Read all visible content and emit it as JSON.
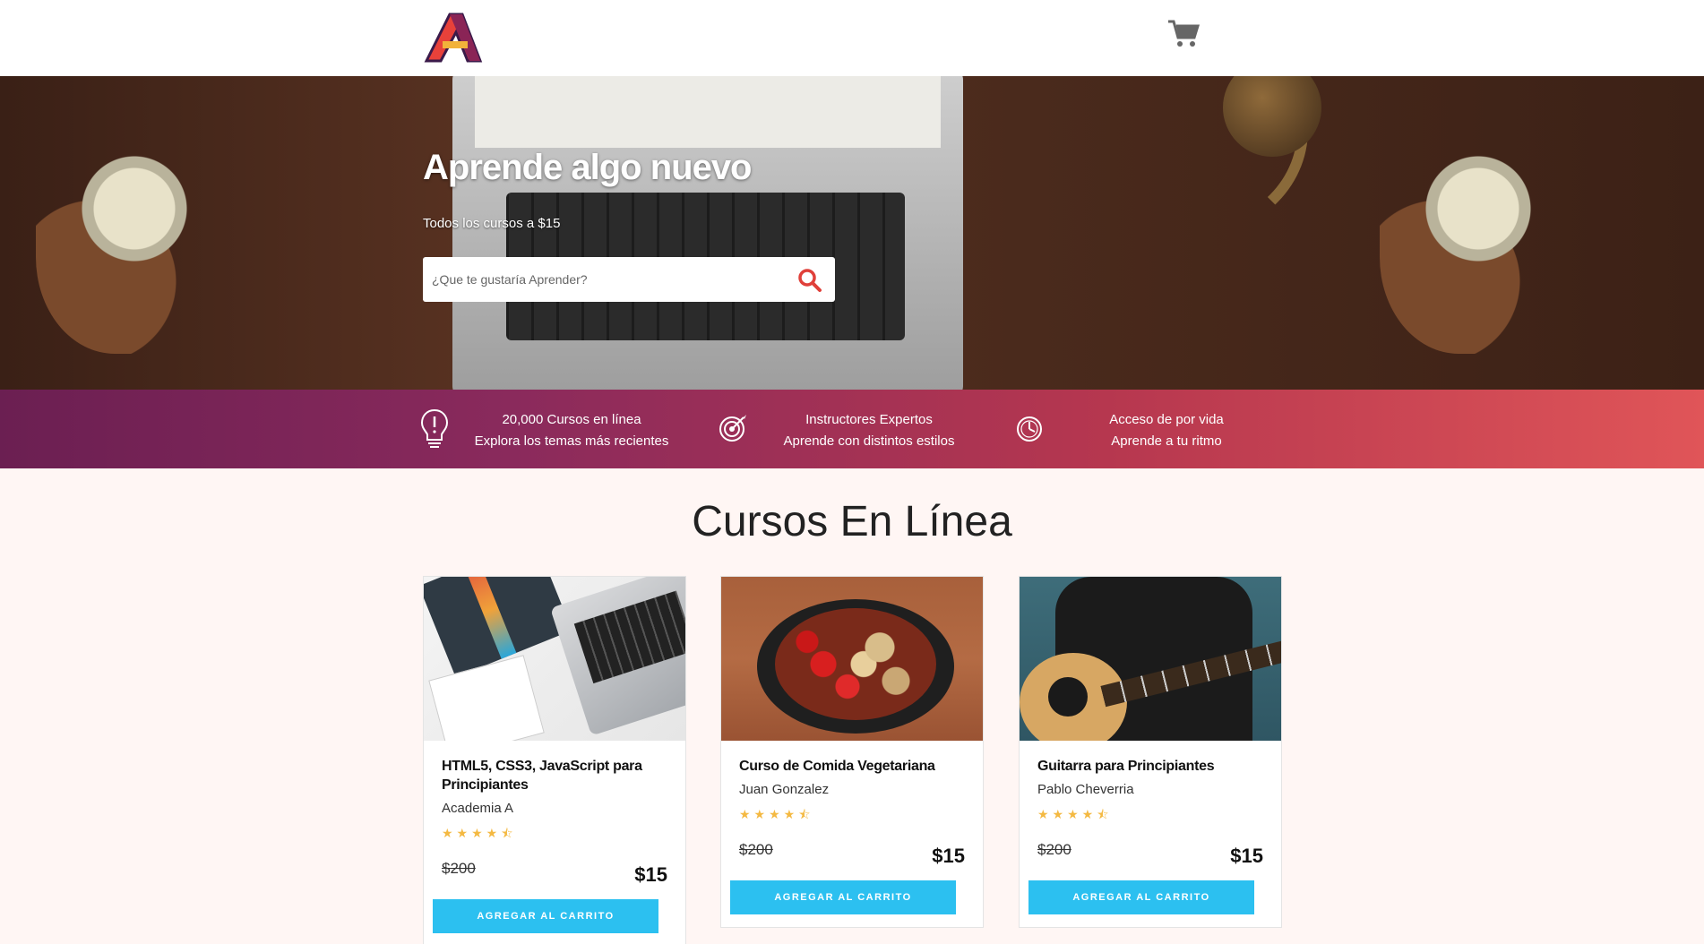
{
  "header": {
    "logo_letter": "A",
    "cart_icon": "shopping-cart-icon"
  },
  "hero": {
    "title": "Aprende algo nuevo",
    "subtitle": "Todos los cursos a $15",
    "search_placeholder": "¿Que te gustaría Aprender?",
    "search_icon": "search-icon"
  },
  "features": [
    {
      "icon": "lightbulb-icon",
      "line1": "20,000 Cursos en línea",
      "line2": "Explora los temas más recientes"
    },
    {
      "icon": "target-icon",
      "line1": "Instructores Expertos",
      "line2": "Aprende con distintos estilos"
    },
    {
      "icon": "clock-icon",
      "line1": "Acceso de por vida",
      "line2": "Aprende a tu ritmo"
    }
  ],
  "section": {
    "title": "Cursos En Línea"
  },
  "courses": [
    {
      "title": "HTML5, CSS3, JavaScript para Principiantes",
      "author": "Academia A",
      "rating": 4.5,
      "stars": "★★★★⯪",
      "old_price": "$200",
      "price": "$15",
      "button": "AGREGAR AL CARRITO"
    },
    {
      "title": "Curso de Comida Vegetariana",
      "author": "Juan Gonzalez",
      "rating": 4.5,
      "stars": "★★★★⯪",
      "old_price": "$200",
      "price": "$15",
      "button": "AGREGAR AL CARRITO"
    },
    {
      "title": "Guitarra para Principiantes",
      "author": "Pablo Cheverria",
      "rating": 4.5,
      "stars": "★★★★⯪",
      "old_price": "$200",
      "price": "$15",
      "button": "AGREGAR AL CARRITO"
    }
  ],
  "colors": {
    "accent_button": "#2cc0f0",
    "feature_gradient_start": "#6b1f52",
    "feature_gradient_end": "#e05558",
    "star": "#f4b942",
    "search_icon": "#e0403a"
  }
}
